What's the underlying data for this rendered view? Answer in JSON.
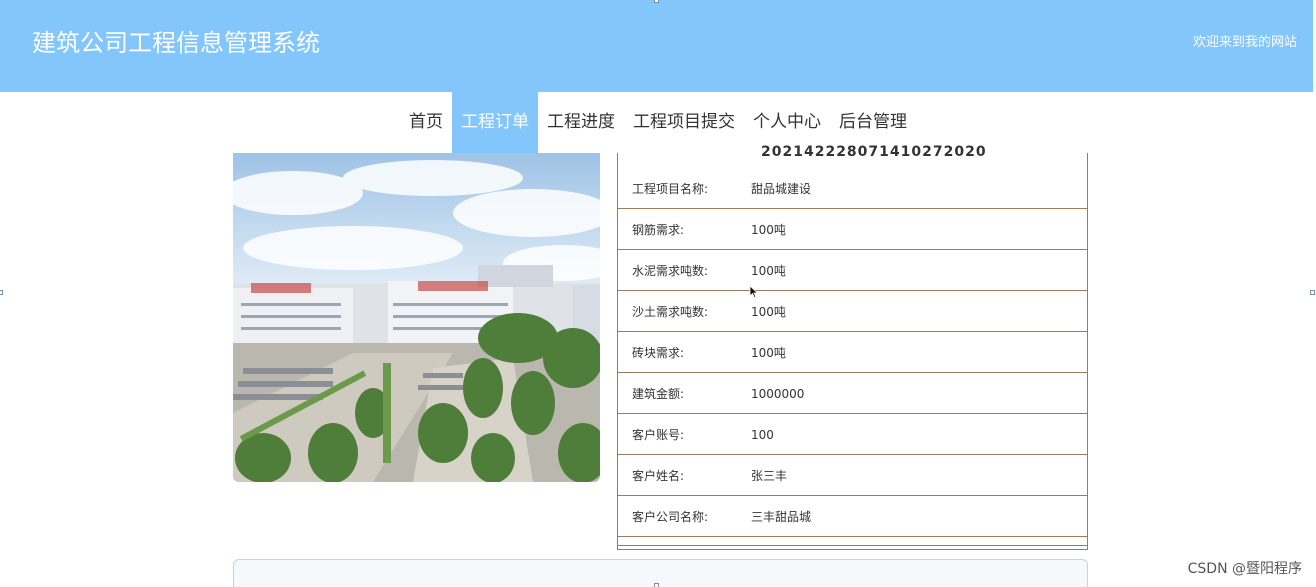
{
  "header": {
    "site_title": "建筑公司工程信息管理系统",
    "welcome": "欢迎来到我的网站"
  },
  "nav": {
    "items": [
      {
        "label": "首页"
      },
      {
        "label": "工程订单"
      },
      {
        "label": "工程进度"
      },
      {
        "label": "工程项目提交"
      },
      {
        "label": "个人中心"
      },
      {
        "label": "后台管理"
      }
    ],
    "active_index": 1
  },
  "detail": {
    "order_number": "202142228071410272020",
    "rows": [
      {
        "label": "工程项目名称:",
        "value": "甜品城建设"
      },
      {
        "label": "钢筋需求:",
        "value": "100吨"
      },
      {
        "label": "水泥需求吨数:",
        "value": "100吨"
      },
      {
        "label": "沙土需求吨数:",
        "value": "100吨"
      },
      {
        "label": "砖块需求:",
        "value": "100吨"
      },
      {
        "label": "建筑金额:",
        "value": "1000000"
      },
      {
        "label": "客户账号:",
        "value": "100"
      },
      {
        "label": "客户姓名:",
        "value": "张三丰"
      },
      {
        "label": "客户公司名称:",
        "value": "三丰甜品城"
      }
    ]
  },
  "watermark": "CSDN @暨阳程序",
  "colors": {
    "header_bg": "#82c6fb",
    "row_border": "#9c7a5e",
    "panel_border": "#b8d8ee"
  },
  "icons": {
    "cursor": "mouse-pointer-icon"
  }
}
